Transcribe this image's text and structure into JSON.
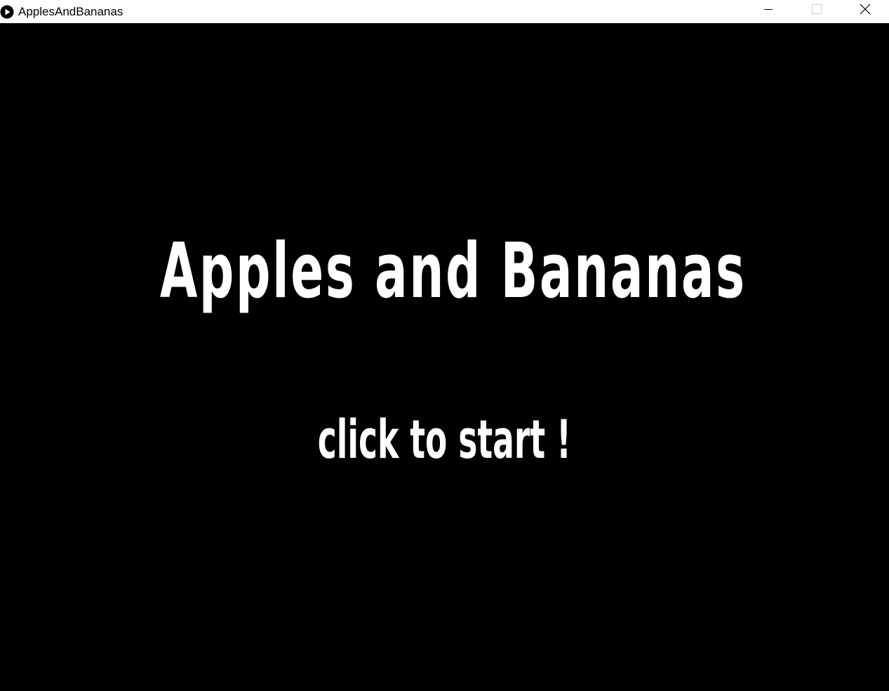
{
  "window": {
    "title": "ApplesAndBananas",
    "icon": "play-circle-icon",
    "controls": [
      "minimize-icon",
      "maximize-icon",
      "close-icon"
    ]
  },
  "game": {
    "title": "Apples and Bananas",
    "prompt": "click to start !",
    "background_color": "#000000",
    "text_color": "#ffffff"
  }
}
